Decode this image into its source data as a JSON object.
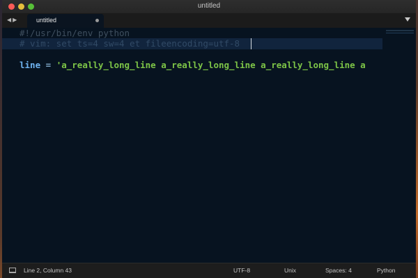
{
  "window": {
    "title": "untitled"
  },
  "tabs": [
    {
      "label": "untitled",
      "modified": true
    }
  ],
  "editor": {
    "lines": [
      "#!/usr/bin/env python",
      "# vim: set ts=4 sw=4 et fileencoding=utf-8",
      "",
      "line = 'a_really_long_line a_really_long_line a_really_long_line a"
    ],
    "line4": {
      "keyword": "line",
      "operator": " = ",
      "string": "'a_really_long_line a_really_long_line a_really_long_line a"
    }
  },
  "statusbar": {
    "position": "Line 2, Column 43",
    "encoding": "UTF-8",
    "line_endings": "Unix",
    "indentation": "Spaces: 4",
    "syntax": "Python"
  },
  "colors": {
    "editor_bg": "#071320",
    "highlight_line": "#11243d",
    "comment": "#3f4f5f",
    "keyword": "#6fb3f0",
    "string": "#7dc447"
  },
  "icons": [
    "back-arrow-icon",
    "forward-arrow-icon",
    "tab-modified-dot-icon",
    "tab-menu-chevron-icon",
    "panel-toggle-icon"
  ]
}
